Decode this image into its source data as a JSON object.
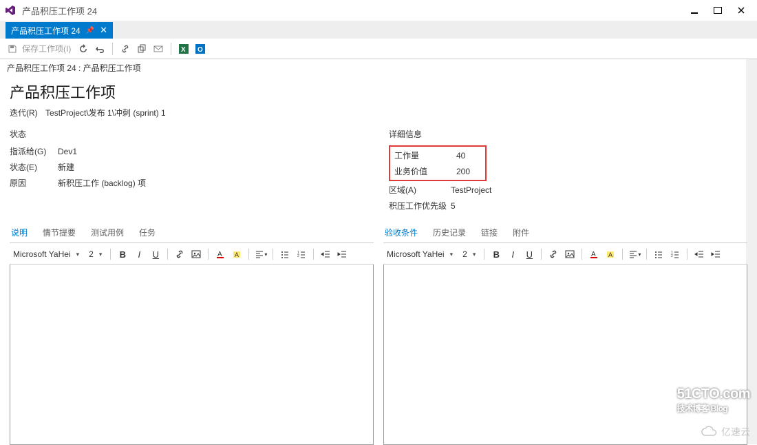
{
  "window": {
    "title": "产品积压工作项 24"
  },
  "tab": {
    "label": "产品积压工作项 24"
  },
  "toolbar": {
    "save_label": "保存工作项(I)"
  },
  "breadcrumb": "产品积压工作项 24 : 产品积压工作项",
  "page": {
    "title": "产品积压工作项",
    "iteration_label": "迭代(R)",
    "iteration_value": "TestProject\\发布 1\\冲刺 (sprint) 1"
  },
  "status": {
    "header": "状态",
    "assigned_label": "指派给(G)",
    "assigned_value": "Dev1",
    "state_label": "状态(E)",
    "state_value": "新建",
    "reason_label": "原因",
    "reason_value": "新积压工作 (backlog) 项"
  },
  "details": {
    "header": "详细信息",
    "effort_label": "工作量",
    "effort_value": "40",
    "bizvalue_label": "业务价值",
    "bizvalue_value": "200",
    "area_label": "区域(A)",
    "area_value": "TestProject",
    "priority_label": "积压工作优先级",
    "priority_value": "5"
  },
  "left_tabs": [
    "说明",
    "情节提要",
    "测试用例",
    "任务"
  ],
  "right_tabs": [
    "验收条件",
    "历史记录",
    "链接",
    "附件"
  ],
  "editor": {
    "font": "Microsoft YaHei",
    "size": "2"
  },
  "watermark": {
    "top": "51CTO.com",
    "sub": "技术博客",
    "blog": "Blog",
    "bottom": "亿速云"
  }
}
